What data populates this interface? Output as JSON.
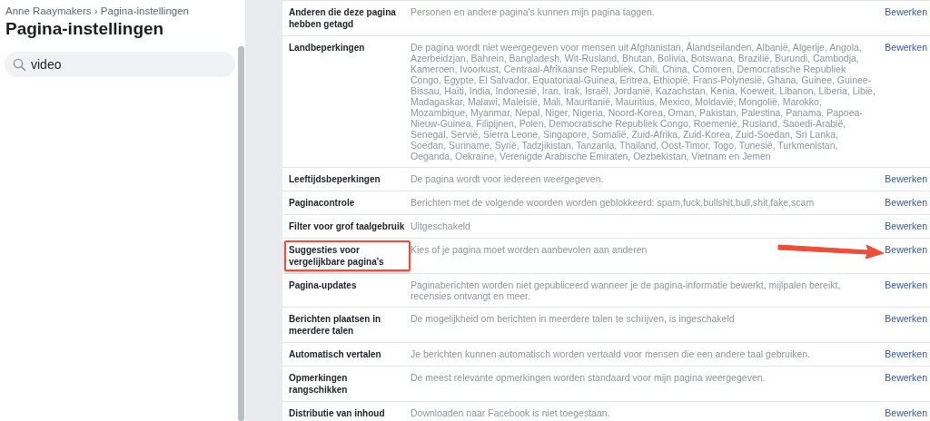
{
  "sidebar": {
    "breadcrumb": "Anne Raaymakers › Pagina-instellingen",
    "title": "Pagina-instellingen",
    "search": {
      "value": "video"
    }
  },
  "settings": [
    {
      "label": "Anderen die deze pagina hebben getagd",
      "description": "Personen en andere pagina's kunnen mijn pagina taggen.",
      "action": "Bewerken",
      "highlighted": false
    },
    {
      "label": "Landbeperkingen",
      "description": "De pagina wordt niet weergegeven voor mensen uit Afghanistan, Ålandseilanden, Albanië, Algerije, Angola, Azerbeidzjan, Bahrein, Bangladesh, Wit-Rusland, Bhutan, Bolivia, Botswana, Brazilië, Burundi, Cambodja, Kameroen, Ivoorkust, Centraal-Afrikaanse Republiek, Chili, China, Comoren, Democratische Republiek Congo, Egypte, El Salvador, Equatoriaal-Guinea, Eritrea, Ethiopië, Frans-Polynesië, Ghana, Guinee, Guinee-Bissau, Haïti, India, Indonesië, Iran, Irak, Israël, Jordanië, Kazachstan, Kenia, Koeweit, Libanon, Liberia, Libië, Madagaskar, Malawi, Maleisië, Mali, Mauritanië, Mauritius, Mexico, Moldavië, Mongolië, Marokko, Mozambique, Myanmar, Nepal, Niger, Nigeria, Noord-Korea, Oman, Pakistan, Palestina, Panama, Papoea-Nieuw-Guinea, Filipijnen, Polen, Democratische Republiek Congo, Roemenië, Rusland, Saoedi-Arabië, Senegal, Servië, Sierra Leone, Singapore, Somalië, Zuid-Afrika, Zuid-Korea, Zuid-Soedan, Sri Lanka, Soedan, Suriname, Syrië, Tadzjikistan, Tanzania, Thailand, Oost-Timor, Togo, Tunesië, Turkmenistan, Oeganda, Oekraïne, Verenigde Arabische Emiraten, Oezbekistan, Vietnam en Jemen",
      "action": "Bewerken",
      "highlighted": false
    },
    {
      "label": "Leeftijdsbeperkingen",
      "description": "De pagina wordt voor iedereen weergegeven.",
      "action": "Bewerken",
      "highlighted": false
    },
    {
      "label": "Paginacontrole",
      "description": "Berichten met de volgende woorden worden geblokkeerd: spam,fuck,bullshit,bull,shit,fake,scam",
      "action": "Bewerken",
      "highlighted": false
    },
    {
      "label": "Filter voor grof taalgebruik",
      "description": "Uitgeschakeld",
      "action": "Bewerken",
      "highlighted": false
    },
    {
      "label": "Suggesties voor vergelijkbare pagina's",
      "description": "Kies of je pagina moet worden aanbevolen aan anderen",
      "action": "Bewerken",
      "highlighted": true
    },
    {
      "label": "Pagina-updates",
      "description": "Paginaberichten worden niet gepubliceerd wanneer je de pagina-informatie bewerkt, mijlpalen bereikt, recensies ontvangt en meer.",
      "action": "Bewerken",
      "highlighted": false
    },
    {
      "label": "Berichten plaatsen in meerdere talen",
      "description": "De mogelijkheid om berichten in meerdere talen te schrijven, is ingeschakeld",
      "action": "Bewerken",
      "highlighted": false
    },
    {
      "label": "Automatisch vertalen",
      "description": "Je berichten kunnen automatisch worden vertaald voor mensen die een andere taal gebruiken.",
      "action": "Bewerken",
      "highlighted": false
    },
    {
      "label": "Opmerkingen rangschikken",
      "description": "De meest relevante opmerkingen worden standaard voor mijn pagina weergegeven.",
      "action": "Bewerken",
      "highlighted": false
    },
    {
      "label": "Distributie van inhoud",
      "description": "Downloaden naar Facebook is niet toegestaan.",
      "action": "Bewerken",
      "highlighted": false
    }
  ]
}
